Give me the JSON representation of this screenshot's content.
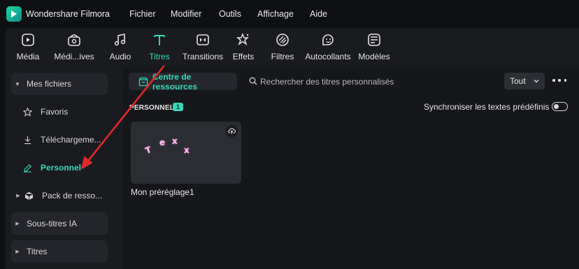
{
  "app": {
    "name": "Wondershare Filmora"
  },
  "menu": [
    "Fichier",
    "Modifier",
    "Outils",
    "Affichage",
    "Aide"
  ],
  "toolbar": {
    "items": [
      {
        "label": "Média",
        "icon": "media-icon"
      },
      {
        "label": "Médi...ives",
        "icon": "stock-media-icon"
      },
      {
        "label": "Audio",
        "icon": "audio-icon"
      },
      {
        "label": "Titres",
        "icon": "titles-icon",
        "active": true
      },
      {
        "label": "Transitions",
        "icon": "transitions-icon"
      },
      {
        "label": "Effets",
        "icon": "effects-icon"
      },
      {
        "label": "Filtres",
        "icon": "filters-icon"
      },
      {
        "label": "Autocollants",
        "icon": "stickers-icon"
      },
      {
        "label": "Modèles",
        "icon": "templates-icon"
      }
    ]
  },
  "sidebar": {
    "items": [
      {
        "label": "Mes fichiers",
        "type": "section",
        "expanded": true
      },
      {
        "label": "Favoris",
        "icon": "star-icon"
      },
      {
        "label": "Téléchargeme...",
        "icon": "download-icon"
      },
      {
        "label": "Personnel",
        "icon": "pencil-icon",
        "active": true
      },
      {
        "label": "Pack de resso...",
        "icon": "package-icon"
      },
      {
        "label": "Sous-titres IA",
        "type": "section"
      },
      {
        "label": "Titres",
        "type": "section"
      }
    ]
  },
  "content": {
    "resource_button": "Centre de ressources",
    "search_placeholder": "Rechercher des titres personnalisés",
    "filter": {
      "selected": "Tout"
    },
    "section_title": "PERSONNEL",
    "section_count": "1",
    "sync_label": "Synchroniser les textes prédéfinis",
    "sync_enabled": false,
    "cards": [
      {
        "name": "Mon préréglage1",
        "preview_text": [
          "T",
          "e",
          "x",
          "x"
        ]
      }
    ]
  },
  "colors": {
    "accent": "#36d7b7",
    "annotation_arrow": "#e0282a",
    "background": "#16171a",
    "panel": "#1a1b1f"
  }
}
